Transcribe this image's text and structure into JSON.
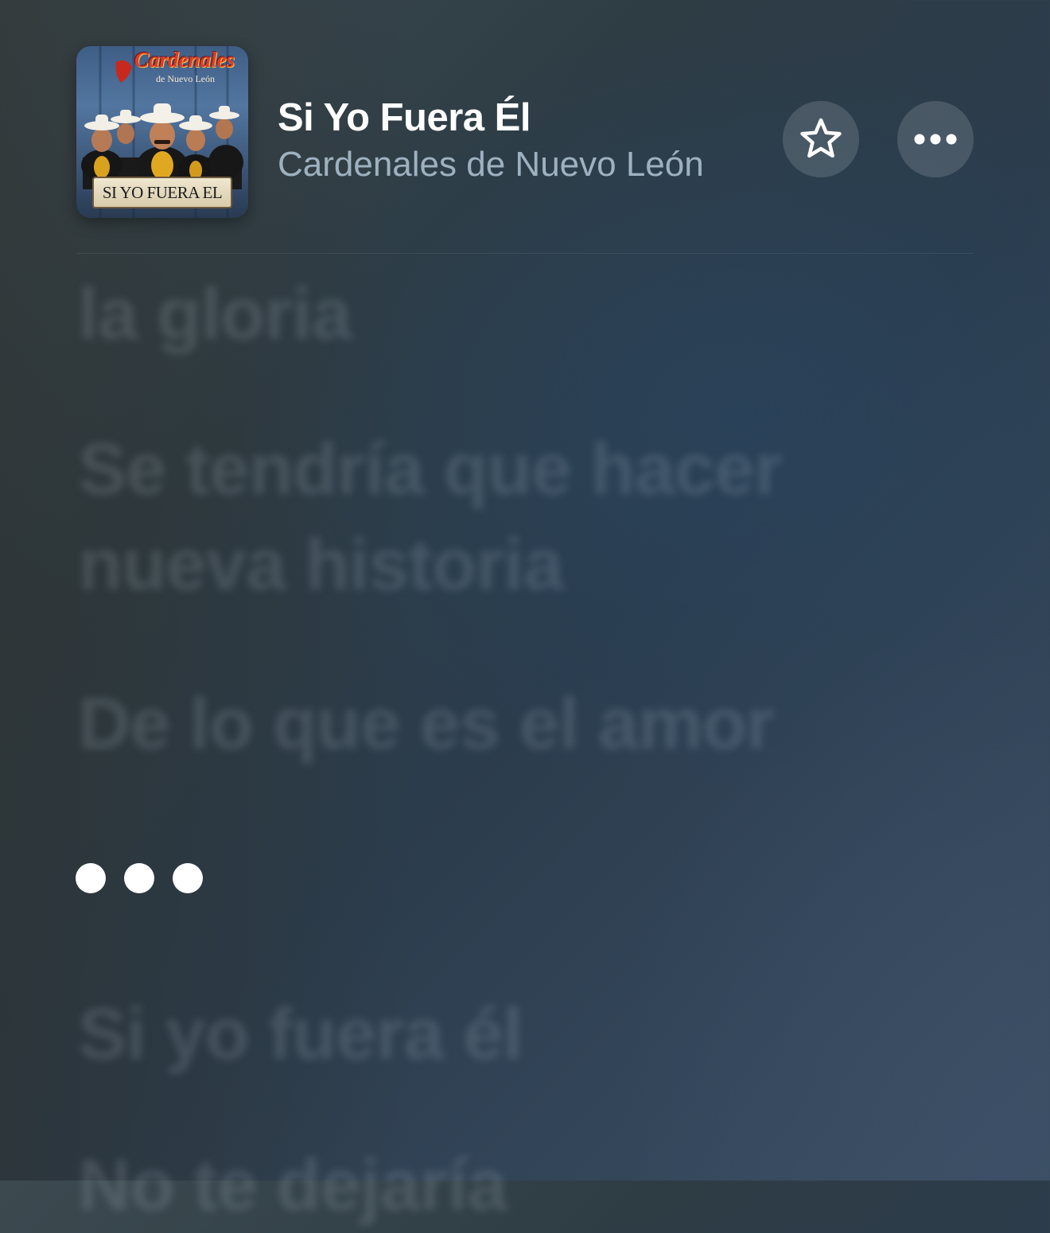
{
  "now_playing": {
    "title": "Si Yo Fuera Él",
    "artist": "Cardenales de Nuevo León",
    "artwork": {
      "logo_text": "Cardenales",
      "logo_subtext": "de Nuevo León",
      "plaque_text": "SI YO FUERA EL"
    },
    "favorite_icon": "star-outline-icon",
    "more_icon": "ellipsis-icon"
  },
  "lyrics": {
    "lines": [
      "la gloria",
      "Se tendría que hacer",
      "nueva historia",
      "De lo que es el amor",
      "Si yo fuera él",
      "No te dejaría"
    ],
    "instrumental_indicator": "•••"
  },
  "colors": {
    "background": "#2e3e4c",
    "title": "#ffffff",
    "artist": "#bed2e1",
    "dots": "#ffffff"
  }
}
